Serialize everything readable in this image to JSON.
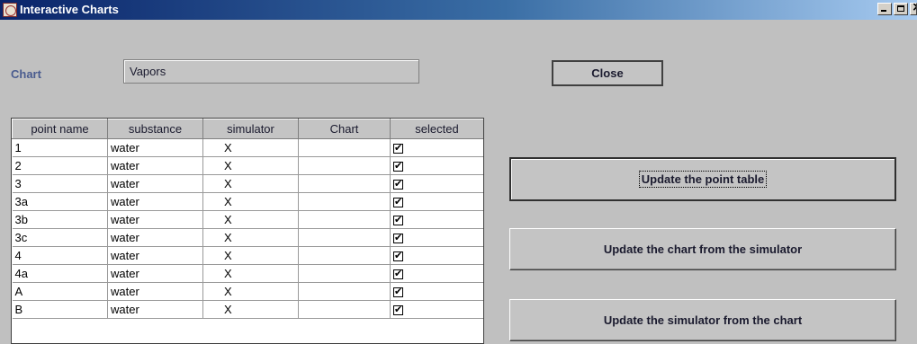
{
  "window": {
    "title": "Interactive Charts"
  },
  "chart": {
    "label": "Chart",
    "value": "Vapors"
  },
  "buttons": {
    "close": "Close",
    "update_table": "Update the point table",
    "update_chart": "Update the chart from the simulator",
    "update_simulator": "Update the simulator from the chart"
  },
  "table": {
    "columns": [
      "point name",
      "substance",
      "simulator",
      "Chart",
      "selected"
    ],
    "rows": [
      {
        "point_name": "1",
        "substance": "water",
        "simulator": "X",
        "chart": "",
        "selected": true
      },
      {
        "point_name": "2",
        "substance": "water",
        "simulator": "X",
        "chart": "",
        "selected": true
      },
      {
        "point_name": "3",
        "substance": "water",
        "simulator": "X",
        "chart": "",
        "selected": true
      },
      {
        "point_name": "3a",
        "substance": "water",
        "simulator": "X",
        "chart": "",
        "selected": true
      },
      {
        "point_name": "3b",
        "substance": "water",
        "simulator": "X",
        "chart": "",
        "selected": true
      },
      {
        "point_name": "3c",
        "substance": "water",
        "simulator": "X",
        "chart": "",
        "selected": true
      },
      {
        "point_name": "4",
        "substance": "water",
        "simulator": "X",
        "chart": "",
        "selected": true
      },
      {
        "point_name": "4a",
        "substance": "water",
        "simulator": "X",
        "chart": "",
        "selected": true
      },
      {
        "point_name": "A",
        "substance": "water",
        "simulator": "X",
        "chart": "",
        "selected": true
      },
      {
        "point_name": "B",
        "substance": "water",
        "simulator": "X",
        "chart": "",
        "selected": true
      }
    ]
  },
  "icons": {
    "app": "java-cup-icon",
    "minimize": "minimize-icon",
    "maximize": "maximize-icon",
    "close": "close-icon"
  }
}
